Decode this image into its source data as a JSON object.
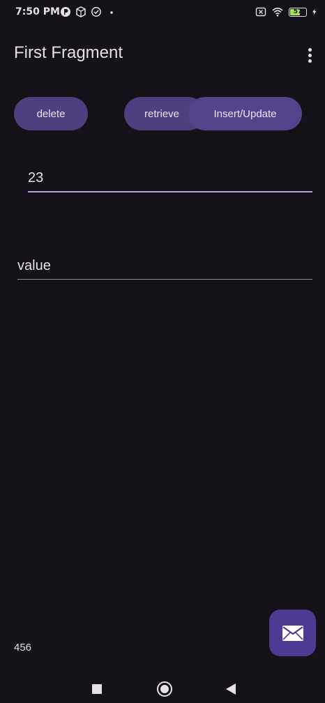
{
  "status_bar": {
    "time": "7:50 PM",
    "battery_level": "57",
    "icons": [
      "p-app-icon",
      "box-icon",
      "check-circle-icon",
      "dot-icon",
      "x-box-icon",
      "wifi-icon",
      "battery-icon",
      "charging-bolt-icon"
    ]
  },
  "app_bar": {
    "title": "First Fragment",
    "menu_icon": "more-vert-icon"
  },
  "buttons": {
    "delete_label": "delete",
    "retrieve_label": "retrieve",
    "insert_label": "Insert/Update"
  },
  "fields": {
    "key_value": "23",
    "value_value": "value"
  },
  "result": {
    "text": "456"
  },
  "fab": {
    "icon": "email-icon"
  },
  "colors": {
    "background": "#141218",
    "button": "#4f3f7f",
    "button_text": "#ece4ff",
    "fab": "#4f3a93",
    "field_underline_focused": "#b6a6d6"
  }
}
